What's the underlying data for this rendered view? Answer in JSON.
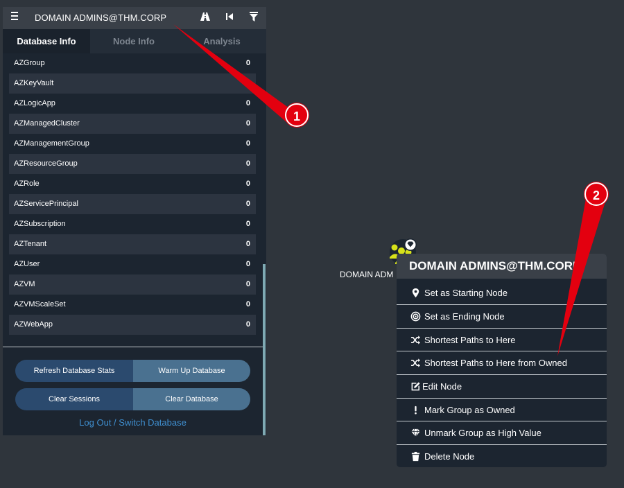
{
  "topbar": {
    "search_value": "DOMAIN ADMINS@THM.CORP"
  },
  "tabs": [
    {
      "label": "Database Info",
      "active": true
    },
    {
      "label": "Node Info",
      "active": false
    },
    {
      "label": "Analysis",
      "active": false
    }
  ],
  "table": {
    "rows": [
      {
        "name": "AZGroup",
        "count": "0"
      },
      {
        "name": "AZKeyVault",
        "count": ""
      },
      {
        "name": "AZLogicApp",
        "count": "0"
      },
      {
        "name": "AZManagedCluster",
        "count": "0"
      },
      {
        "name": "AZManagementGroup",
        "count": "0"
      },
      {
        "name": "AZResourceGroup",
        "count": "0"
      },
      {
        "name": "AZRole",
        "count": "0"
      },
      {
        "name": "AZServicePrincipal",
        "count": "0"
      },
      {
        "name": "AZSubscription",
        "count": "0"
      },
      {
        "name": "AZTenant",
        "count": "0"
      },
      {
        "name": "AZUser",
        "count": "0"
      },
      {
        "name": "AZVM",
        "count": "0"
      },
      {
        "name": "AZVMScaleSet",
        "count": "0"
      },
      {
        "name": "AZWebApp",
        "count": "0"
      }
    ]
  },
  "buttons": {
    "refresh_stats": "Refresh Database Stats",
    "warm_up": "Warm Up Database",
    "clear_sessions": "Clear Sessions",
    "clear_database": "Clear Database"
  },
  "logout_link": "Log Out / Switch Database",
  "graph": {
    "node_label": "DOMAIN ADM"
  },
  "context_menu": {
    "title": "DOMAIN ADMINS@THM.CORP",
    "items": [
      {
        "label": "Set as Starting Node",
        "icon": "map-pin-icon"
      },
      {
        "label": "Set as Ending Node",
        "icon": "target-icon"
      },
      {
        "label": "Shortest Paths to Here",
        "icon": "shuffle-icon"
      },
      {
        "label": "Shortest Paths to Here from Owned",
        "icon": "shuffle-icon"
      },
      {
        "label": "Edit Node",
        "icon": "edit-icon"
      },
      {
        "label": "Mark Group as Owned",
        "icon": "exclamation-icon"
      },
      {
        "label": "Unmark Group as High Value",
        "icon": "gem-icon"
      },
      {
        "label": "Delete Node",
        "icon": "trash-icon"
      }
    ]
  },
  "annotations": [
    {
      "label": "1"
    },
    {
      "label": "2"
    }
  ],
  "colors": {
    "panel_bg": "#1c2530",
    "canvas_bg": "#2f353c",
    "button_dark": "#2b4a6e",
    "button_light": "#4a7190",
    "link": "#3f8fd0",
    "annotation_red": "#e3000f",
    "node_yellow": "#d6e11a"
  }
}
